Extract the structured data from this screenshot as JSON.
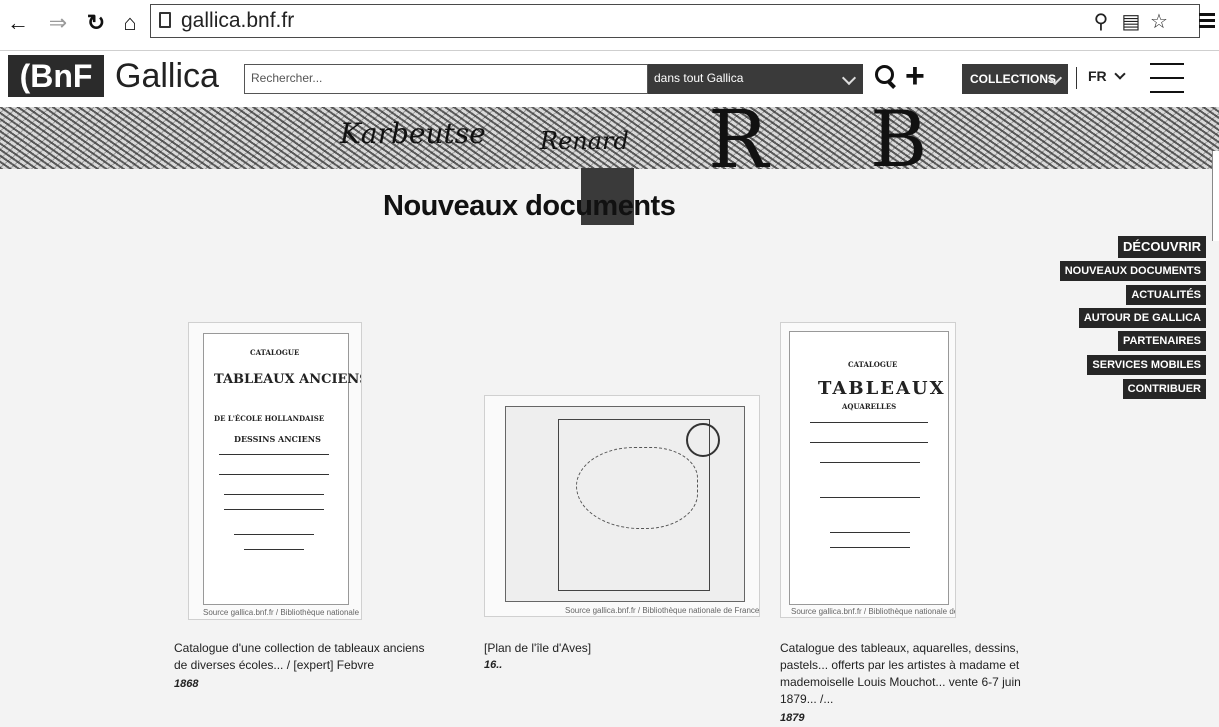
{
  "browser": {
    "url": "gallica.bnf.fr",
    "back_icon": "arrow-left",
    "forward_icon": "arrow-right",
    "reload_icon": "reload",
    "home_icon": "home"
  },
  "header": {
    "logo": "BnF",
    "site_name": "Gallica",
    "search_placeholder": "Rechercher...",
    "scope": "dans tout Gallica",
    "collections": "COLLECTIONS",
    "lang": "FR"
  },
  "banner": {
    "glyphs": [
      "Karbeutse",
      "Renard",
      "R",
      "B"
    ]
  },
  "page_title": "Nouveaux documents",
  "side_nav": {
    "header": "DÉCOUVRIR",
    "items": [
      "NOUVEAUX DOCUMENTS",
      "ACTUALITÉS",
      "AUTOUR DE GALLICA",
      "PARTENAIRES",
      "SERVICES MOBILES",
      "CONTRIBUER"
    ]
  },
  "documents": [
    {
      "title": "Catalogue d'une collection de tableaux anciens de diverses écoles... / [expert] Febvre",
      "date": "1868",
      "source": "Source gallica.bnf.fr / Bibliothèque nationale de France",
      "cover_lines": [
        "CATALOGUE",
        "TABLEAUX ANCIENS",
        "DE L'ÉCOLE HOLLANDAISE",
        "DESSINS ANCIENS"
      ]
    },
    {
      "title": "[Plan de l'île d'Aves]",
      "date": "16..",
      "source": "Source gallica.bnf.fr / Bibliothèque nationale de France",
      "cover_lines": []
    },
    {
      "title": "Catalogue des tableaux, aquarelles, dessins, pastels... offerts par les artistes à madame et mademoiselle Louis Mouchot... vente 6-7 juin 1879... /...",
      "date": "1879",
      "source": "Source gallica.bnf.fr / Bibliothèque nationale de France",
      "cover_lines": [
        "CATALOGUE",
        "TABLEAUX",
        "AQUARELLES"
      ]
    }
  ]
}
